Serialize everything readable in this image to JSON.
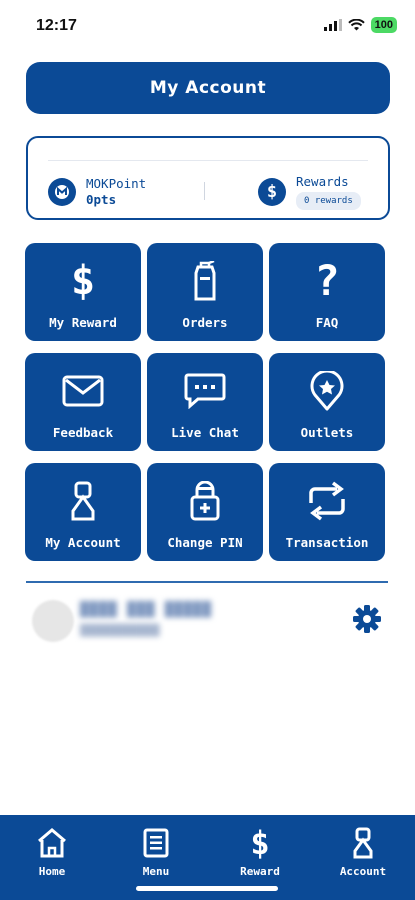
{
  "status": {
    "time": "12:17",
    "battery": "100"
  },
  "header": {
    "title": "My Account"
  },
  "points_card": {
    "points_label": "MOKPoint",
    "points_value": "0pts",
    "rewards_label": "Rewards",
    "rewards_value": "0 rewards"
  },
  "menu": {
    "tiles": [
      {
        "label": "My Reward",
        "icon": "dollar-icon"
      },
      {
        "label": "Orders",
        "icon": "cup-icon"
      },
      {
        "label": "FAQ",
        "icon": "question-icon"
      },
      {
        "label": "Feedback",
        "icon": "envelope-icon"
      },
      {
        "label": "Live Chat",
        "icon": "chat-icon"
      },
      {
        "label": "Outlets",
        "icon": "location-pin-icon"
      },
      {
        "label": "My Account",
        "icon": "person-icon"
      },
      {
        "label": "Change PIN",
        "icon": "lock-icon"
      },
      {
        "label": "Transaction",
        "icon": "refresh-icon"
      }
    ]
  },
  "bottom_nav": {
    "items": [
      {
        "label": "Home",
        "icon": "home-icon"
      },
      {
        "label": "Menu",
        "icon": "menu-icon"
      },
      {
        "label": "Reward",
        "icon": "dollar-icon"
      },
      {
        "label": "Account",
        "icon": "person-icon"
      }
    ]
  },
  "colors": {
    "primary": "#0b4a96",
    "background": "#ffffff",
    "accent_text": "#ffffff"
  }
}
